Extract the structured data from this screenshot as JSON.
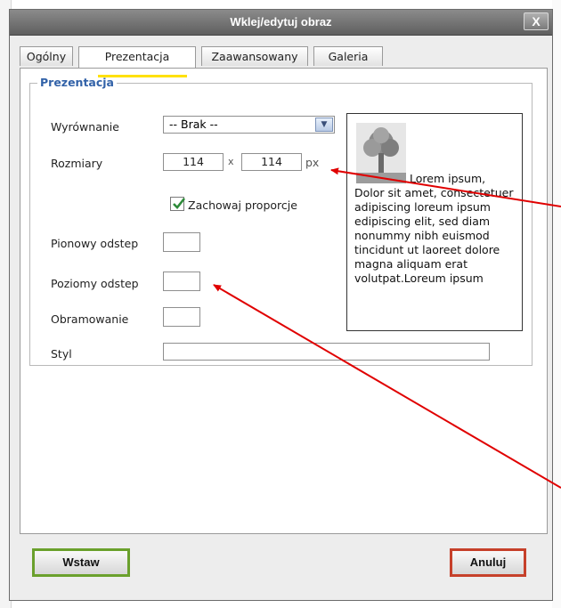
{
  "dialog": {
    "title": "Wklej/edytuj obraz",
    "close_label": "X"
  },
  "tabs": [
    {
      "label": "Ogólny",
      "active": false
    },
    {
      "label": "Prezentacja",
      "active": true
    },
    {
      "label": "Zaawansowany",
      "active": false
    },
    {
      "label": "Galeria",
      "active": false
    }
  ],
  "group": {
    "legend": "Prezentacja",
    "alignment": {
      "label": "Wyrównanie",
      "selected": "-- Brak --"
    },
    "size": {
      "label": "Rozmiary",
      "width": "114",
      "separator": "x",
      "height": "114",
      "unit": "px"
    },
    "keep_proportions": {
      "label": "Zachowaj proporcje",
      "checked": true
    },
    "vspace": {
      "label": "Pionowy odstep",
      "value": ""
    },
    "hspace": {
      "label": "Poziomy odstep",
      "value": ""
    },
    "border": {
      "label": "Obramowanie",
      "value": ""
    },
    "style": {
      "label": "Styl",
      "value": ""
    }
  },
  "preview": {
    "text": "Lorem ipsum, Dolor sit amet, consectetuer adipiscing loreum ipsum edipiscing elit, sed diam nonummy nibh euismod tincidunt ut laoreet dolore magna aliquam erat volutpat.Loreum ipsum"
  },
  "buttons": {
    "insert": "Wstaw",
    "cancel": "Anuluj"
  },
  "colors": {
    "titlebar": "#6f6f6f",
    "legend": "#3262a8",
    "tab_highlight": "#ffe100",
    "insert_border": "#6aa02c",
    "cancel_border": "#c6402a",
    "annotation_arrow": "#e00000"
  }
}
